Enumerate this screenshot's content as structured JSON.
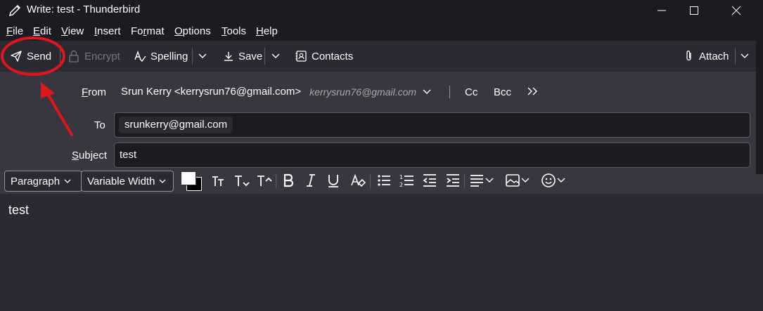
{
  "window": {
    "title": "Write: test - Thunderbird"
  },
  "menubar": {
    "items": [
      {
        "accel": "F",
        "rest": "ile"
      },
      {
        "accel": "E",
        "rest": "dit"
      },
      {
        "accel": "V",
        "rest": "iew"
      },
      {
        "accel": "I",
        "rest": "nsert"
      },
      {
        "pre": "Fo",
        "accel": "r",
        "rest": "mat"
      },
      {
        "accel": "O",
        "rest": "ptions"
      },
      {
        "accel": "T",
        "rest": "ools"
      },
      {
        "accel": "H",
        "rest": "elp"
      }
    ]
  },
  "toolbar": {
    "send": "Send",
    "encrypt": "Encrypt",
    "spelling": "Spelling",
    "save": "Save",
    "contacts": "Contacts",
    "attach": "Attach"
  },
  "headers": {
    "from_label_accel": "F",
    "from_label_rest": "rom",
    "from_identity": "Srun Kerry <kerrysrun76@gmail.com>",
    "from_address": "kerrysrun76@gmail.com",
    "cc": "Cc",
    "bcc": "Bcc",
    "to_label": "To",
    "to_recipient": "srunkerry@gmail.com",
    "subject_label_accel": "S",
    "subject_label_rest": "ubject",
    "subject_value": "test"
  },
  "formatbar": {
    "paragraph": "Paragraph",
    "font": "Variable Width"
  },
  "body": {
    "text": "test"
  },
  "colors": {
    "annotation": "#e0161b",
    "background": "#1c1b22",
    "toolbar": "#2b2a33",
    "header": "#38373f"
  }
}
